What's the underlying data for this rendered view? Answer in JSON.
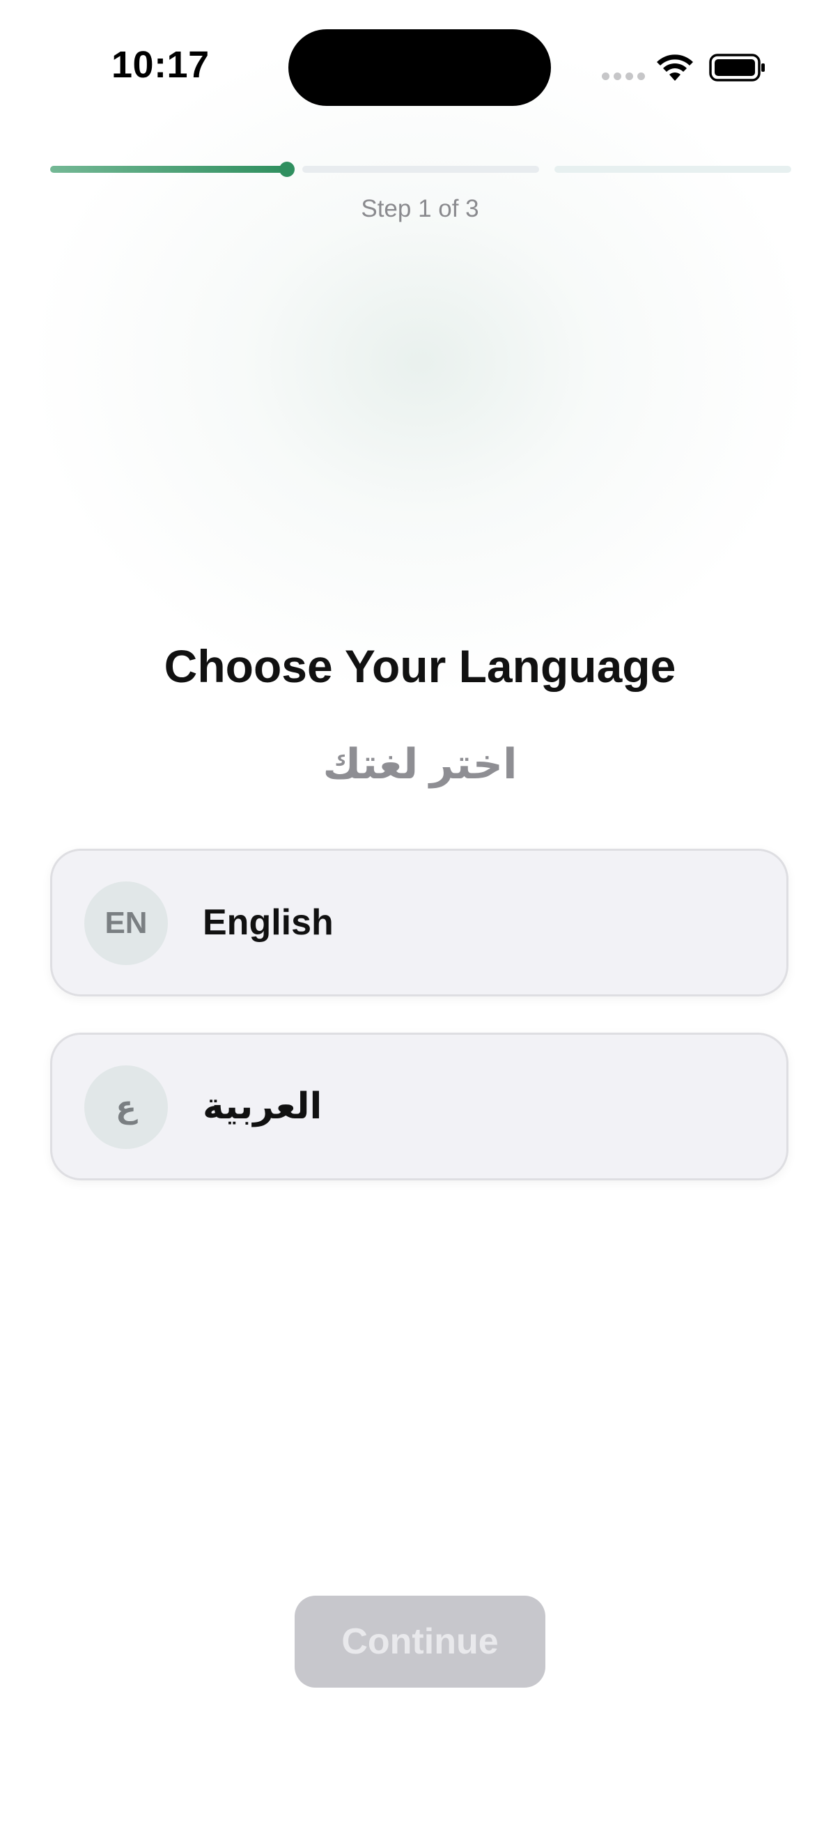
{
  "status_bar": {
    "time": "10:17",
    "icons": [
      "signal-dots-icon",
      "wifi-icon",
      "battery-icon"
    ]
  },
  "progress": {
    "step_label": "Step 1 of 3",
    "current_step": 1,
    "total_steps": 3,
    "segment_fill": [
      1.0,
      0.0,
      0.0
    ],
    "accent_color": "#2f8f5f"
  },
  "header": {
    "title": "Choose Your Language",
    "subtitle": "اختر لغتك"
  },
  "options": [
    {
      "badge": "EN",
      "label": "English"
    },
    {
      "badge": "ع",
      "label": "العربية"
    }
  ],
  "continue": {
    "label": "Continue",
    "enabled": false
  }
}
